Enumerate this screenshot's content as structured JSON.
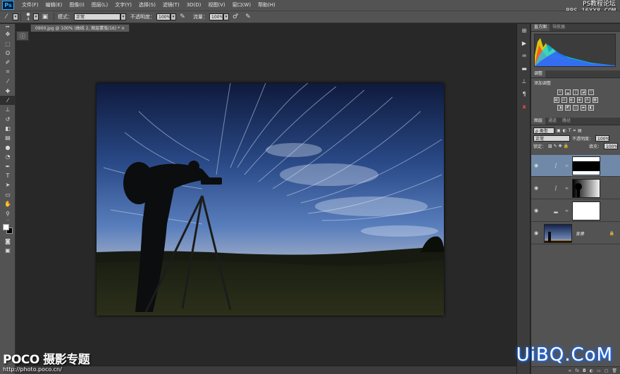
{
  "app": {
    "logo": "Ps"
  },
  "menu": [
    "文件(F)",
    "编辑(E)",
    "图像(I)",
    "图层(L)",
    "文字(Y)",
    "选择(S)",
    "滤镜(T)",
    "3D(D)",
    "视图(V)",
    "窗口(W)",
    "帮助(H)"
  ],
  "options": {
    "brush_size": "4",
    "mode_label": "模式：",
    "mode_value": "正常",
    "opacity_label": "不透明度：",
    "opacity_value": "100%",
    "flow_label": "流量：",
    "flow_value": "100%"
  },
  "document": {
    "tab_title": "0900.jpg @ 100% (曲线 2, 图层蒙版/16) *"
  },
  "panels": {
    "histogram_tabs": [
      "直方图",
      "导航器"
    ],
    "adjustments_tab": "调整",
    "adjustments_title": "添加调整",
    "layers_tabs": [
      "图层",
      "通道",
      "路径"
    ],
    "kind_filter": "ρ 类型",
    "blend_mode": "正常",
    "opacity_label": "不透明度：",
    "opacity_value": "100%",
    "lock_label": "锁定：",
    "fill_label": "填充：",
    "fill_value": "100%",
    "background_layer": "背景"
  },
  "watermarks": {
    "top_right_1": "PS教程论坛",
    "top_right_2": "BBS.16XX8.COM",
    "poco_big": "POCO 摄影专题",
    "poco_url": "http://photo.poco.cn/",
    "uibq": "UiBQ.CoM"
  },
  "colors": {
    "chrome": "#535353",
    "canvas_bg": "#282828",
    "selected_layer": "#7089a8",
    "accent": "#31a8ff"
  }
}
